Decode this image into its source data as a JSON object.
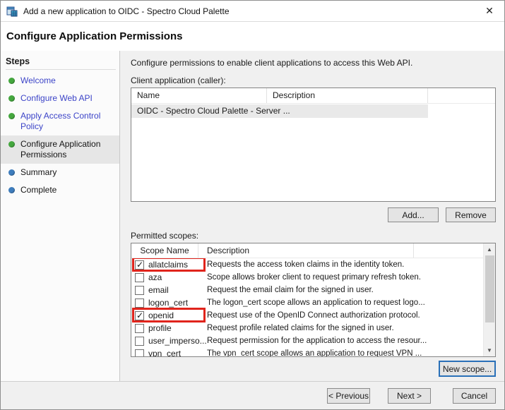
{
  "window": {
    "title": "Add a new application to OIDC - Spectro Cloud Palette",
    "close_glyph": "✕"
  },
  "header": {
    "title": "Configure Application Permissions"
  },
  "sidebar": {
    "title": "Steps",
    "items": [
      {
        "label": "Welcome",
        "state": "done"
      },
      {
        "label": "Configure Web API",
        "state": "done"
      },
      {
        "label": "Apply Access Control Policy",
        "state": "done"
      },
      {
        "label": "Configure Application Permissions",
        "state": "current"
      },
      {
        "label": "Summary",
        "state": "upcoming"
      },
      {
        "label": "Complete",
        "state": "upcoming"
      }
    ]
  },
  "main": {
    "intro": "Configure permissions to enable client applications to access this Web API.",
    "client_section": {
      "label": "Client application (caller):",
      "columns": [
        "Name",
        "Description"
      ],
      "rows": [
        {
          "name": "OIDC - Spectro Cloud Palette - Server ...",
          "description": ""
        }
      ],
      "add_label": "Add...",
      "remove_label": "Remove"
    },
    "scopes_section": {
      "label": "Permitted scopes:",
      "columns": [
        "Scope Name",
        "Description"
      ],
      "rows": [
        {
          "name": "allatclaims",
          "checked": true,
          "highlighted": true,
          "description": "Requests the access token claims in the identity token."
        },
        {
          "name": "aza",
          "checked": false,
          "highlighted": false,
          "description": "Scope allows broker client to request primary refresh token."
        },
        {
          "name": "email",
          "checked": false,
          "highlighted": false,
          "description": "Request the email claim for the signed in user."
        },
        {
          "name": "logon_cert",
          "checked": false,
          "highlighted": false,
          "description": "The logon_cert scope allows an application to request logo..."
        },
        {
          "name": "openid",
          "checked": true,
          "highlighted": true,
          "description": "Request use of the OpenID Connect authorization protocol."
        },
        {
          "name": "profile",
          "checked": false,
          "highlighted": false,
          "description": "Request profile related claims for the signed in user."
        },
        {
          "name": "user_imperso...",
          "checked": false,
          "highlighted": false,
          "description": "Request permission for the application to access the resour..."
        },
        {
          "name": "vpn_cert",
          "checked": false,
          "highlighted": false,
          "description": "The vpn_cert scope allows an application to request VPN ..."
        }
      ],
      "scrollbar": {
        "up_glyph": "▲",
        "down_glyph": "▼"
      },
      "new_scope_label": "New scope..."
    }
  },
  "footer": {
    "previous_label": "< Previous",
    "next_label": "Next >",
    "cancel_label": "Cancel"
  },
  "colors": {
    "highlight_red": "#e0241c",
    "focus_blue": "#2a70b8",
    "link_blue": "#3c44c8",
    "step_done_green": "#44a73e",
    "step_upcoming_blue": "#3e7dbd"
  }
}
